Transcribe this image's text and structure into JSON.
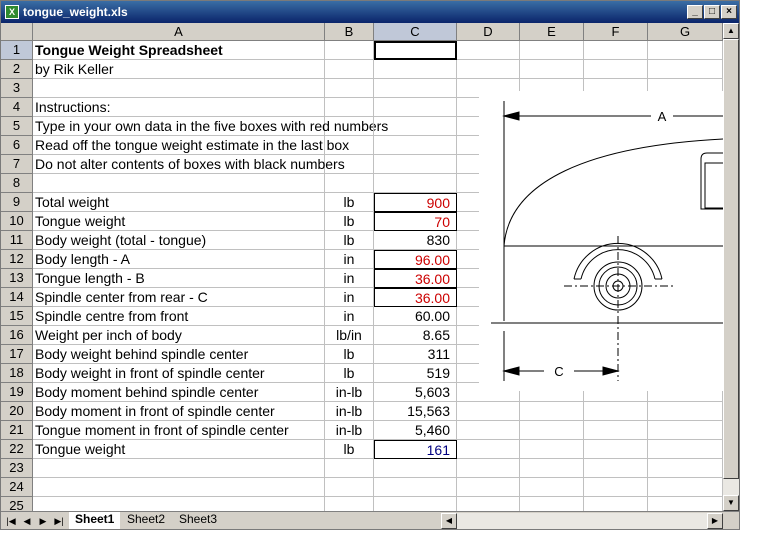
{
  "window": {
    "title": "tongue_weight.xls",
    "icon": "excel-icon"
  },
  "columns": [
    "A",
    "B",
    "C",
    "D",
    "E",
    "F",
    "G"
  ],
  "rows": [
    {
      "n": "1",
      "a": "Tongue Weight Spreadsheet",
      "b": "",
      "c": ""
    },
    {
      "n": "2",
      "a": "by Rik Keller",
      "b": "",
      "c": ""
    },
    {
      "n": "3",
      "a": "",
      "b": "",
      "c": ""
    },
    {
      "n": "4",
      "a": "Instructions:",
      "b": "",
      "c": ""
    },
    {
      "n": "5",
      "a": "Type in your own data in the five boxes with red numbers",
      "b": "",
      "c": ""
    },
    {
      "n": "6",
      "a": "Read off the tongue weight estimate in the last box",
      "b": "",
      "c": ""
    },
    {
      "n": "7",
      "a": "Do not alter contents of boxes with black numbers",
      "b": "",
      "c": ""
    },
    {
      "n": "8",
      "a": "",
      "b": "",
      "c": ""
    },
    {
      "n": "9",
      "a": "Total weight",
      "b": "lb",
      "c": "900"
    },
    {
      "n": "10",
      "a": "Tongue weight",
      "b": "lb",
      "c": "70"
    },
    {
      "n": "11",
      "a": "Body weight (total - tongue)",
      "b": "lb",
      "c": "830"
    },
    {
      "n": "12",
      "a": "Body length - A",
      "b": "in",
      "c": "96.00"
    },
    {
      "n": "13",
      "a": "Tongue length - B",
      "b": "in",
      "c": "36.00"
    },
    {
      "n": "14",
      "a": "Spindle center from rear - C",
      "b": "in",
      "c": "36.00"
    },
    {
      "n": "15",
      "a": "Spindle centre from front",
      "b": "in",
      "c": "60.00"
    },
    {
      "n": "16",
      "a": "Weight per inch of body",
      "b": "lb/in",
      "c": "8.65"
    },
    {
      "n": "17",
      "a": "Body weight behind spindle center",
      "b": "lb",
      "c": "311"
    },
    {
      "n": "18",
      "a": "Body weight in front of spindle center",
      "b": "lb",
      "c": "519"
    },
    {
      "n": "19",
      "a": "Body moment behind spindle center",
      "b": "in-lb",
      "c": "5,603"
    },
    {
      "n": "20",
      "a": "Body moment in front of spindle center",
      "b": "in-lb",
      "c": "15,563"
    },
    {
      "n": "21",
      "a": "Tongue moment in front of spindle center",
      "b": "in-lb",
      "c": "5,460"
    },
    {
      "n": "22",
      "a": "Tongue weight",
      "b": "lb",
      "c": "161"
    },
    {
      "n": "23",
      "a": "",
      "b": "",
      "c": ""
    },
    {
      "n": "24",
      "a": "",
      "b": "",
      "c": ""
    },
    {
      "n": "25",
      "a": "",
      "b": "",
      "c": ""
    }
  ],
  "drawing": {
    "label_a": "A",
    "label_c": "C"
  },
  "sheets": [
    "Sheet1",
    "Sheet2",
    "Sheet3"
  ],
  "colors": {
    "input_red": "#cc0000",
    "result_blue": "#000080",
    "title_blue": "#0a246a"
  }
}
